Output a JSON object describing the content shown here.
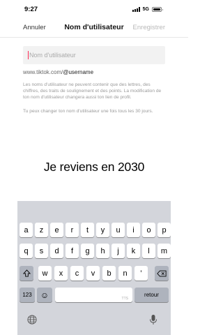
{
  "status": {
    "time": "9:27",
    "network": "5G"
  },
  "nav": {
    "cancel": "Annuler",
    "title": "Nom d'utilisateur",
    "save": "Enregistrer"
  },
  "input": {
    "placeholder": "Nom d'utilisateur",
    "value": ""
  },
  "url": {
    "prefix": "www.tiktok.com/",
    "handle": "@username"
  },
  "help": {
    "line1": "Les noms d'utilisateur ne peuvent contenir que des lettres, des chiffres, des traits de soulignement et des points. La modification de ton nom d'utilisateur changera aussi ton lien de profil.",
    "line2": "Tu peux changer ton nom d'utilisateur une fois tous les 30 jours."
  },
  "caption": "Je reviens en 2030",
  "keyboard": {
    "row1": [
      "a",
      "z",
      "e",
      "r",
      "t",
      "y",
      "u",
      "i",
      "o",
      "p"
    ],
    "row2": [
      "q",
      "s",
      "d",
      "f",
      "g",
      "h",
      "j",
      "k",
      "l",
      "m"
    ],
    "row3": [
      "w",
      "x",
      "c",
      "v",
      "b",
      "n",
      "’"
    ],
    "numbers": "123",
    "emoji": "☺",
    "space_hint": "TTS",
    "return": "retour",
    "icons": {
      "shift": "shift-icon",
      "delete": "delete-icon",
      "globe": "globe-icon",
      "mic": "mic-icon",
      "emoji": "emoji-icon"
    }
  },
  "colors": {
    "caret": "#fe2c55",
    "save_disabled": "#b8b8b8",
    "keyboard_bg": "#d3d5db"
  }
}
